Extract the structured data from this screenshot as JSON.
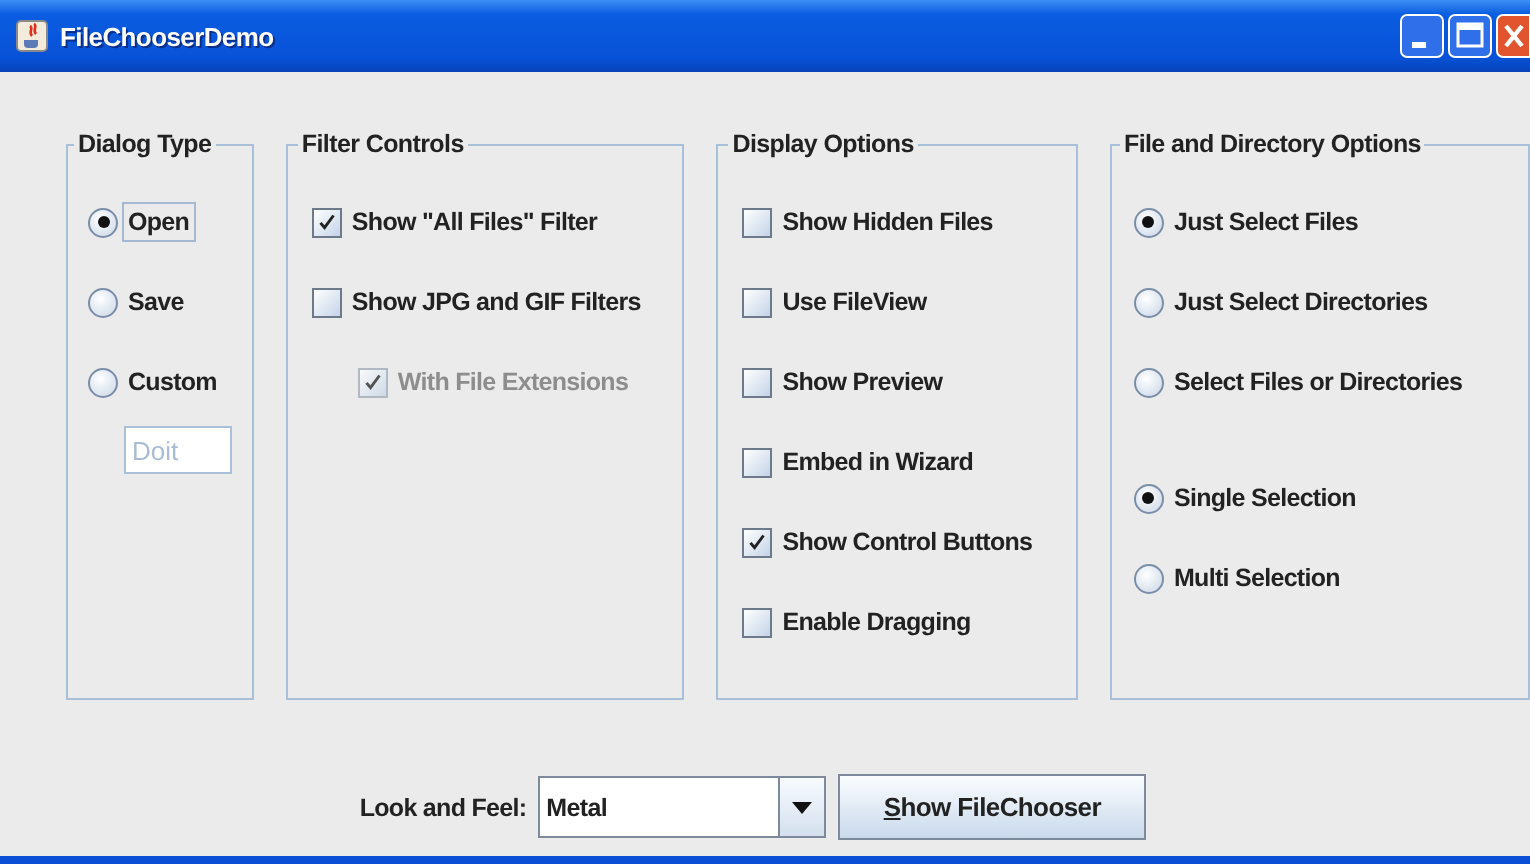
{
  "window": {
    "title": "FileChooserDemo"
  },
  "dialog_type": {
    "title": "Dialog Type",
    "options": [
      {
        "label": "Open",
        "selected": true,
        "focused": true
      },
      {
        "label": "Save",
        "selected": false,
        "focused": false
      },
      {
        "label": "Custom",
        "selected": false,
        "focused": false
      }
    ],
    "custom_field": {
      "value": "Doit",
      "disabled": true
    }
  },
  "filter_controls": {
    "title": "Filter Controls",
    "items": [
      {
        "label": "Show \"All Files\" Filter",
        "checked": true,
        "disabled": false
      },
      {
        "label": "Show JPG and GIF Filters",
        "checked": false,
        "disabled": false,
        "children": [
          {
            "label": "With File Extensions",
            "checked": true,
            "disabled": true
          }
        ]
      }
    ]
  },
  "display_options": {
    "title": "Display Options",
    "items": [
      {
        "label": "Show Hidden Files",
        "checked": false
      },
      {
        "label": "Use FileView",
        "checked": false
      },
      {
        "label": "Show Preview",
        "checked": false
      },
      {
        "label": "Embed in Wizard",
        "checked": false
      },
      {
        "label": "Show Control Buttons",
        "checked": true
      },
      {
        "label": "Enable Dragging",
        "checked": false
      }
    ]
  },
  "file_options": {
    "title": "File and Directory Options",
    "groups": [
      {
        "options": [
          {
            "label": "Just Select Files",
            "selected": true
          },
          {
            "label": "Just Select Directories",
            "selected": false
          },
          {
            "label": "Select Files or Directories",
            "selected": false
          }
        ]
      },
      {
        "options": [
          {
            "label": "Single Selection",
            "selected": true
          },
          {
            "label": "Multi Selection",
            "selected": false
          }
        ]
      }
    ]
  },
  "look_and_feel": {
    "label": "Look and Feel:",
    "value": "Metal"
  },
  "show_button": {
    "label": "Show FileChooser",
    "mnemonic_underlined": true
  }
}
